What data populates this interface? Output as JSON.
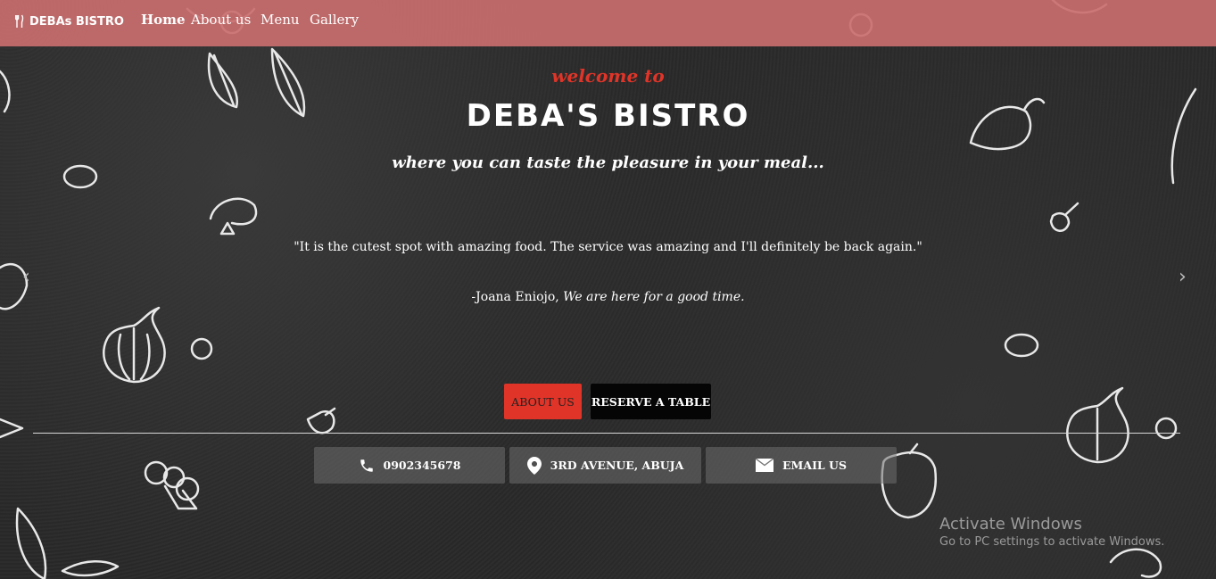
{
  "nav": {
    "brand": "DEBAs BISTRO",
    "links": [
      "Home",
      "About us",
      "Menu",
      "Gallery"
    ]
  },
  "hero": {
    "welcome": "welcome to",
    "title": "DEBA'S BISTRO",
    "tagline": "where you can taste the pleasure in your meal...",
    "quote": "\"It is the cutest spot with amazing food. The service was amazing and I'll definitely be back again.\"",
    "author": "-Joana Eniojo,",
    "author_note": "We are here for a good time."
  },
  "buttons": {
    "about": "ABOUT US",
    "reserve": "RESERVE A TABLE"
  },
  "info": {
    "phone": "0902345678",
    "address": "3RD AVENUE, ABUJA",
    "email": "EMAIL US"
  },
  "carousel": {
    "prev": "‹",
    "next": "›"
  },
  "watermark": {
    "title": "Activate Windows",
    "subtitle": "Go to PC settings to activate Windows."
  },
  "colors": {
    "accent": "#e03428",
    "navbar": "#c96e6e",
    "background": "#2a2a2a"
  }
}
